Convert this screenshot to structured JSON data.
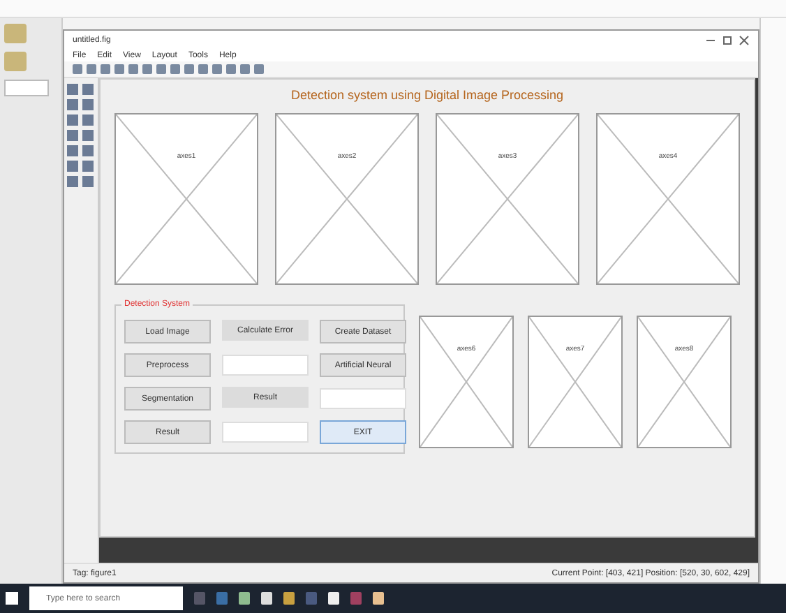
{
  "window": {
    "title": "untitled.fig"
  },
  "menu": [
    "File",
    "Edit",
    "View",
    "Layout",
    "Tools",
    "Help"
  ],
  "figure": {
    "title": "Detection system using Digital Image Processing",
    "top_axes": [
      "axes1",
      "axes2",
      "axes3",
      "axes4"
    ],
    "panel": {
      "title": "Detection System",
      "controls": [
        {
          "kind": "button",
          "label": "Load Image"
        },
        {
          "kind": "label",
          "label": "Calculate Error"
        },
        {
          "kind": "button",
          "label": "Create Dataset"
        },
        {
          "kind": "button",
          "label": "Preprocess"
        },
        {
          "kind": "field"
        },
        {
          "kind": "button",
          "label": "Artificial Neural"
        },
        {
          "kind": "button",
          "label": "Segmentation"
        },
        {
          "kind": "label",
          "label": "Result"
        },
        {
          "kind": "field"
        },
        {
          "kind": "button",
          "label": "Result"
        },
        {
          "kind": "field"
        },
        {
          "kind": "exit",
          "label": "EXIT"
        }
      ]
    },
    "bottom_axes": [
      "axes6",
      "axes7",
      "axes8"
    ]
  },
  "status_bar": {
    "left": "Tag: figure1",
    "right": "Current Point: [403, 421]  Position: [520, 30, 602, 429]"
  },
  "taskbar": {
    "search_placeholder": "Type here to search"
  }
}
